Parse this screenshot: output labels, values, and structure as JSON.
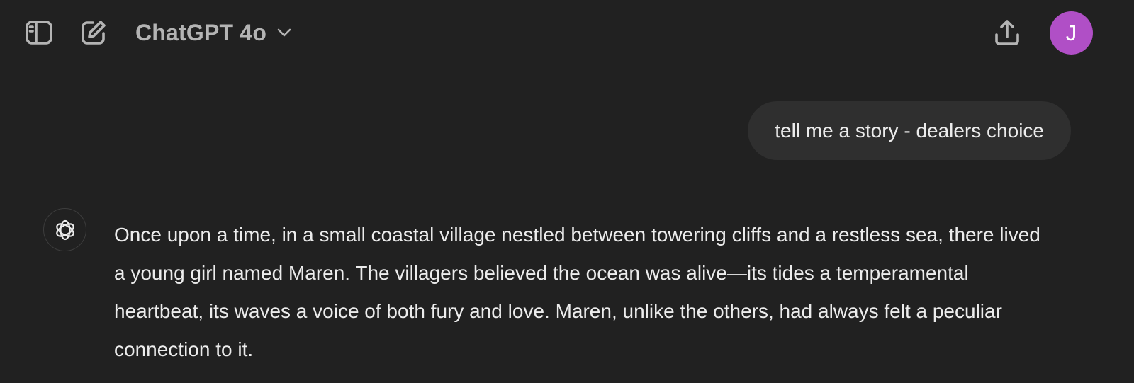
{
  "header": {
    "sidebar_toggle_icon": "sidebar-toggle-icon",
    "new_chat_icon": "edit-icon",
    "model_name": "ChatGPT 4o",
    "model_chevron_icon": "chevron-down-icon",
    "share_icon": "share-icon",
    "avatar_initial": "J",
    "avatar_color": "#b04fc6"
  },
  "conversation": {
    "user_message": "tell me a story - dealers choice",
    "assistant_icon": "openai-logo-icon",
    "assistant_message": "Once upon a time, in a small coastal village nestled between towering cliffs and a restless sea, there lived a young girl named Maren. The villagers believed the ocean was alive—its tides a temperamental heartbeat, its waves a voice of both fury and love. Maren, unlike the others, had always felt a peculiar connection to it."
  },
  "colors": {
    "background": "#212121",
    "bubble": "#2f2f2f",
    "text": "#ececec",
    "muted": "#b4b4b4"
  }
}
